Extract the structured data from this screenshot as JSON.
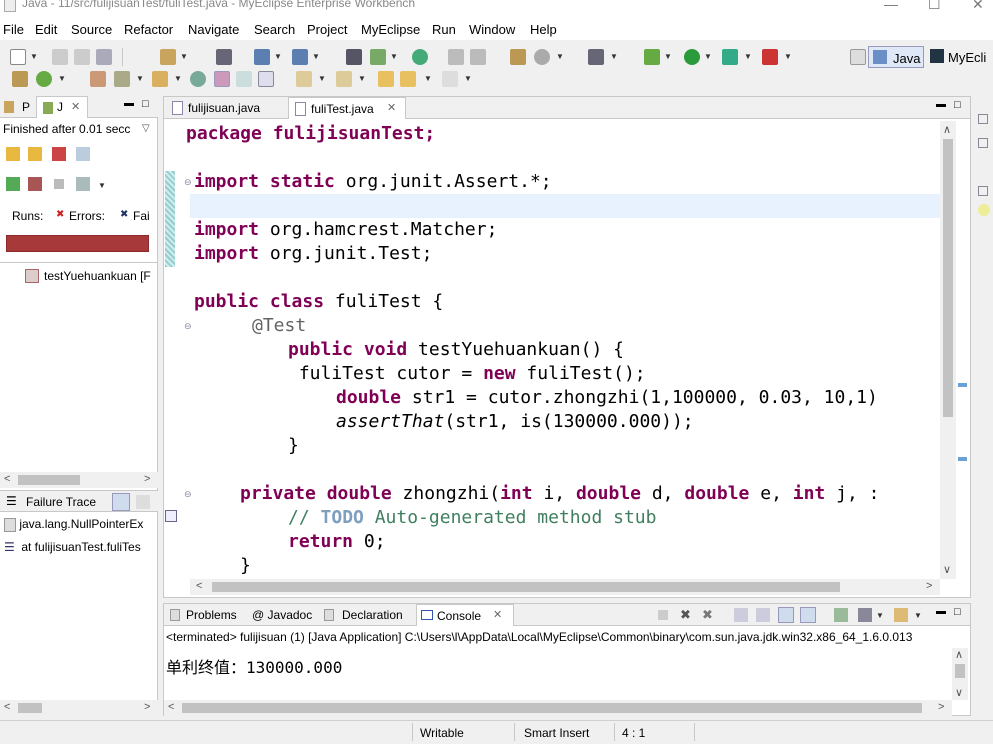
{
  "window": {
    "title": "Java - 11/src/fulijisuanTest/fuliTest.java - MyEclipse Enterprise Workbench"
  },
  "menu": [
    "File",
    "Edit",
    "Source",
    "Refactor",
    "Navigate",
    "Search",
    "Project",
    "MyEclipse",
    "Run",
    "Window",
    "Help"
  ],
  "perspectives": {
    "java": "Java",
    "myeclipse": "MyEcli"
  },
  "left_panel": {
    "tab_p": "P",
    "tab_j": "J",
    "status": "Finished after 0.01 secc",
    "runs_label": "Runs:",
    "errors_label": "Errors:",
    "failures_label": "Fai",
    "test_item": "testYuehuankuan [F",
    "failure_trace_label": "Failure Trace",
    "trace": [
      "java.lang.NullPointerEx",
      "at fulijisuanTest.fuliTes"
    ]
  },
  "editor": {
    "tabs": [
      "fulijisuan.java",
      "fuliTest.java"
    ],
    "active_tab": "fuliTest.java"
  },
  "code_lines": {
    "l1": "package fulijisuanTest;",
    "l3a": "import static",
    "l3b": " org.junit.Assert.*;",
    "l5a": "import",
    "l5b": " org.hamcrest.Matcher;",
    "l6a": "import",
    "l6b": " org.junit.Test;",
    "l8a": "public class",
    "l8b": " fuliTest {",
    "l9": "@Test",
    "l10a": "public void",
    "l10b": " testYuehuankuan() {",
    "l11a": " fuliTest cutor = ",
    "l11b": "new",
    "l11c": " fuliTest();",
    "l12a": "double",
    "l12b": " str1 = cutor.zhongzhi(1,100000, 0.03, 10,1)",
    "l13a": "assertThat",
    "l13b": "(str1, is(130000.000));",
    "l14": "}",
    "l16a": "private double",
    "l16b": " zhongzhi(",
    "l16c": "int",
    "l16d": " i, ",
    "l16e": "double",
    "l16f": " d, ",
    "l16g": "double",
    "l16h": " e, ",
    "l16i": "int",
    "l16j": " j, :",
    "l17a": "// ",
    "l17b": "TODO",
    "l17c": " Auto-generated method stub",
    "l18a": "return",
    "l18b": " 0;",
    "l19": "}"
  },
  "console": {
    "tabs": [
      "Problems",
      "@ Javadoc",
      "Declaration",
      "Console"
    ],
    "terminated": "<terminated> fulijisuan (1) [Java Application] C:\\Users\\l\\AppData\\Local\\MyEclipse\\Common\\binary\\com.sun.java.jdk.win32.x86_64_1.6.0.013",
    "output": "单利终值：130000.000"
  },
  "status": {
    "writable": "Writable",
    "insert_mode": "Smart Insert",
    "position": "4 : 1"
  },
  "colors": {
    "junit_fail_bar": "#a8393b",
    "keyword": "#7f0055",
    "comment": "#3f7f5f",
    "current_line": "#e8f2fe"
  }
}
